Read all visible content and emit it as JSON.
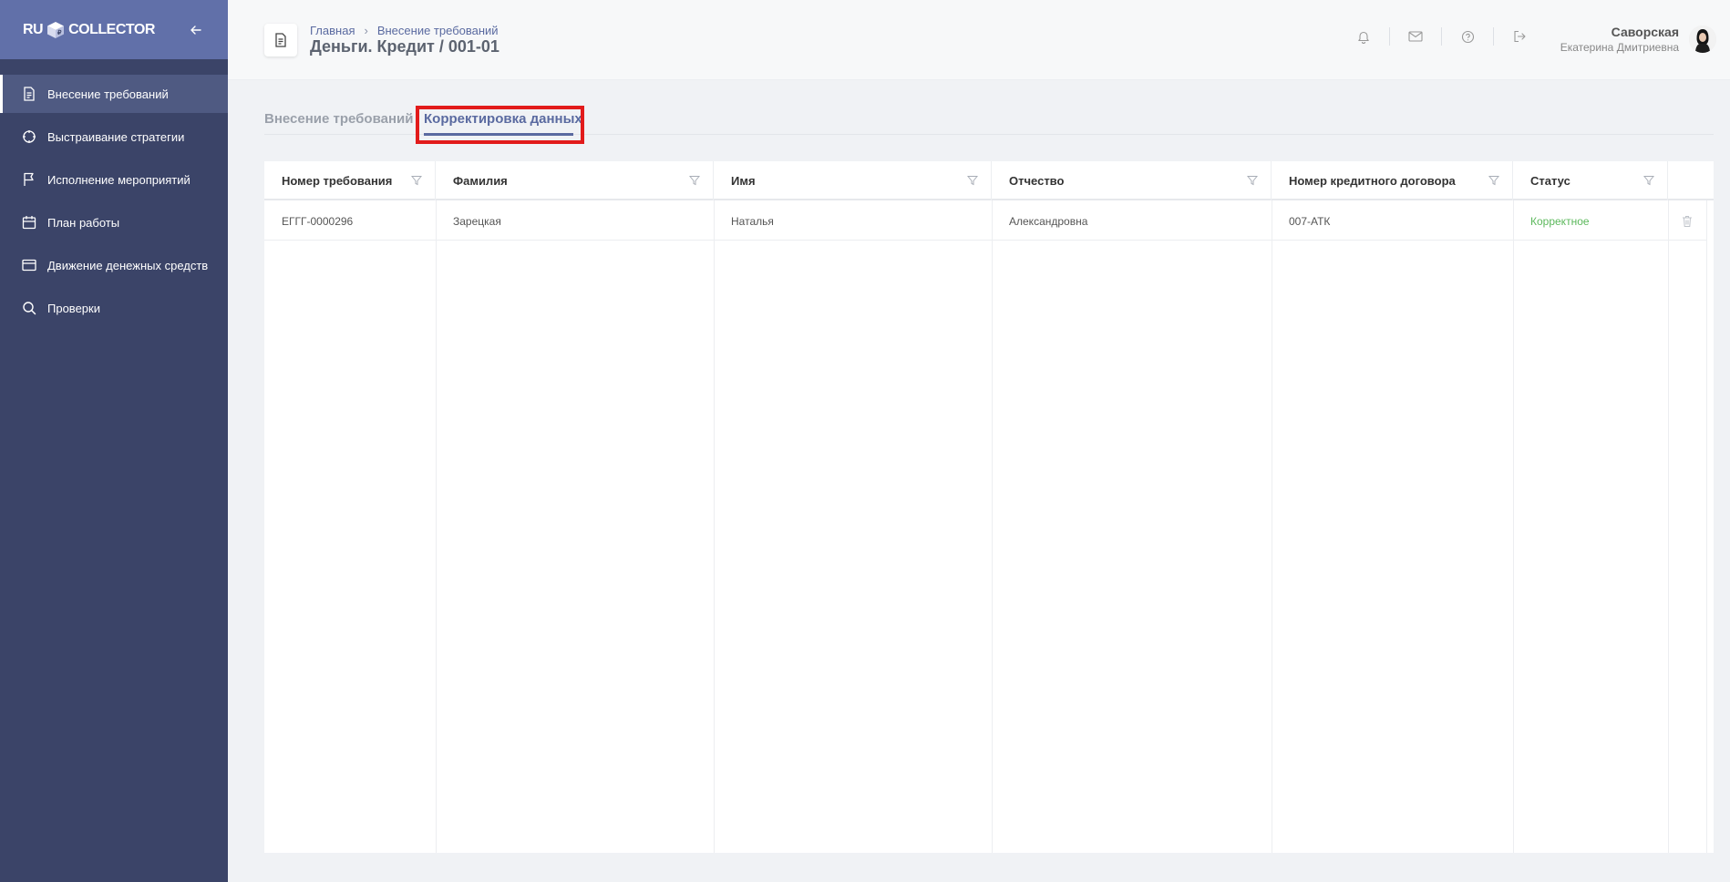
{
  "app": {
    "logo_left": "RU",
    "logo_right": "COLLECTOR"
  },
  "sidebar": {
    "items": [
      {
        "label": "Внесение требований",
        "icon": "document-icon"
      },
      {
        "label": "Выстраивание стратегии",
        "icon": "crosshair-icon"
      },
      {
        "label": "Исполнение мероприятий",
        "icon": "flag-icon"
      },
      {
        "label": "План работы",
        "icon": "calendar-icon"
      },
      {
        "label": "Движение денежных средств",
        "icon": "credit-card-icon"
      },
      {
        "label": "Проверки",
        "icon": "search-icon"
      }
    ],
    "active_index": 0
  },
  "header": {
    "breadcrumb": [
      "Главная",
      "Внесение требований"
    ],
    "title": "Деньги. Кредит / 001-01",
    "user_surname": "Саворская",
    "user_name": "Екатерина Дмитриевна"
  },
  "tabs": [
    {
      "label": "Внесение требований",
      "active": false
    },
    {
      "label": "Корректировка данных",
      "active": true
    }
  ],
  "table": {
    "columns": [
      "Номер требования",
      "Фамилия",
      "Имя",
      "Отчество",
      "Номер кредитного договора",
      "Статус"
    ],
    "rows": [
      {
        "request_number": "ЕГГГ-0000296",
        "surname": "Зарецкая",
        "name": "Наталья",
        "patronymic": "Александровна",
        "contract_number": "007-АТК",
        "status": "Корректное"
      }
    ]
  },
  "colors": {
    "sidebar_bg": "#3b4468",
    "sidebar_header": "#6170a9",
    "accent": "#5a6aa0",
    "status_ok": "#5cb85c",
    "highlight": "#e21b1b"
  }
}
